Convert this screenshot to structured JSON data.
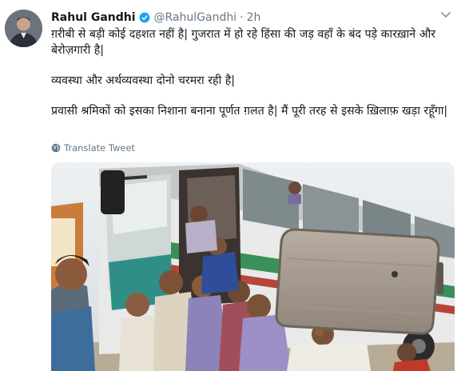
{
  "tweet": {
    "author": {
      "display_name": "Rahul Gandhi",
      "handle": "@RahulGandhi",
      "verified": true,
      "avatar_icon": "profile-photo"
    },
    "separator": "·",
    "time": "2h",
    "menu_icon": "chevron-down-icon",
    "paragraphs": [
      "ग़रीबी से बड़ी कोई दहशत नहीं है| गुजरात में हो रहे हिंसा की जड़ वहाँ के बंद पड़े कारख़ाने और बेरोज़गारी है|",
      "व्यवस्था और अर्थव्यवस्था दोनो चरमरा रही है|",
      "प्रवासी श्रमिकों को इसका निशाना बनाना पूर्णत ग़लत है| मैं पूरी तरह से इसके ख़िलाफ़ खड़ा रहूँगा|"
    ],
    "translate_label": "Translate Tweet",
    "translate_icon": "globe-icon",
    "media": {
      "kind": "photo",
      "content": "crowd-boarding-bus-photo"
    }
  },
  "colors": {
    "text_primary": "#14171a",
    "text_secondary": "#657786",
    "verified_blue": "#1da1f2"
  }
}
